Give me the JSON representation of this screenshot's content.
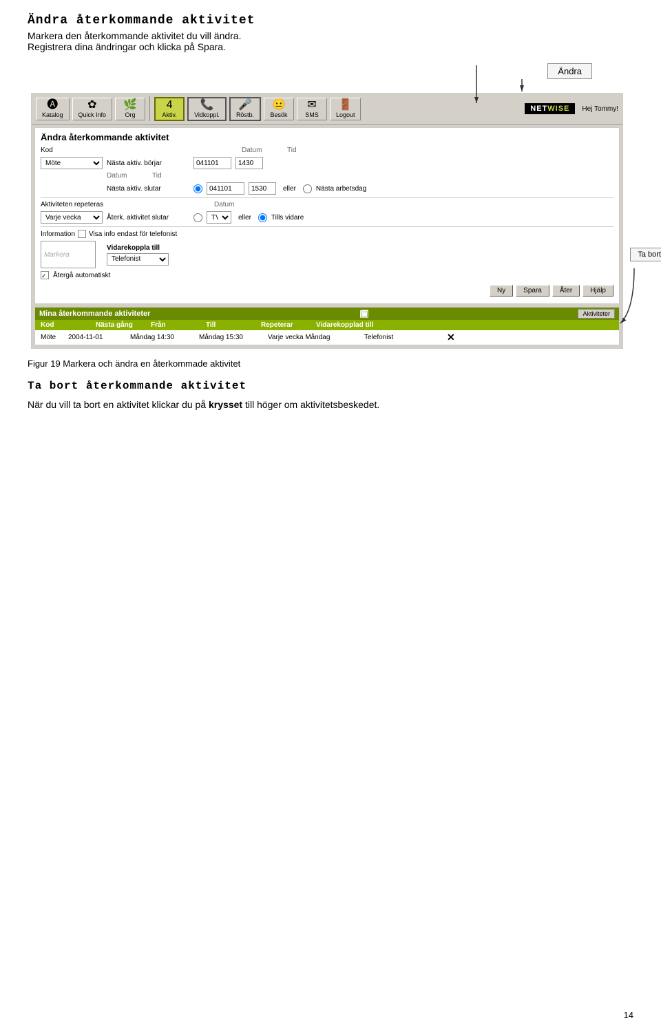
{
  "page": {
    "title": "Ändra återkommande aktivitet",
    "subtitle1": "Markera den återkommande aktivitet du vill ändra.",
    "subtitle2": "Registrera dina ändringar och klicka på Spara.",
    "andra_label": "Ändra",
    "ta_bort_label": "Ta bort",
    "figure_caption": "Figur 19  Markera och ändra en återkommade aktivitet",
    "section2_title": "Ta bort återkommande aktivitet",
    "section2_text": "När du vill ta bort en aktivitet klickar du på",
    "section2_text2": "krysset",
    "section2_text3": "till höger om aktivitetsbeskedet.",
    "page_number": "14"
  },
  "nav": {
    "katalog": "Katalog",
    "quick_info": "Quick Info",
    "org": "Org",
    "aktiv": "Aktiv.",
    "vidkoppl": "Vidkoppl.",
    "rostb": "Röstb.",
    "besok": "Besök",
    "sms": "SMS",
    "logout": "Logout",
    "hej": "Hej Tommy!"
  },
  "form": {
    "title": "Ändra återkommande aktivitet",
    "kod_label": "Kod",
    "datum_label": "Datum",
    "tid_label": "Tid",
    "nasta_aktiv_borjar": "Nästa aktiv. börjar",
    "nasta_aktiv_slutar": "Nästa aktiv. slutar",
    "eller": "eller",
    "nasta_arbetsdag": "Nästa arbetsdag",
    "aktiviteten_repeteras": "Aktiviteten repeteras",
    "aterk_aktivitet_slutar": "Återk. aktivitet slutar",
    "tills_vidare": "Tills vidare",
    "information": "Information",
    "visa_info": "Visa info endast för telefonist",
    "vidarekoppla_till": "Vidarekoppla till",
    "atergaautomatiskt": "Återgå automatiskt",
    "kod_value": "Möte",
    "datum_borjar": "041101",
    "tid_borjar": "1430",
    "datum_slutar": "041101",
    "tid_slutar": "1530",
    "repeteras_value": "Varje vecka",
    "aterk_datum": "TV",
    "vidarekoppla_value": "Telefonist"
  },
  "buttons": {
    "ny": "Ny",
    "spara": "Spara",
    "ater": "Åter",
    "hjalp": "Hjälp"
  },
  "table": {
    "title": "Mina återkommande aktiviteter",
    "aktiviteter_btn": "Aktiviteter",
    "headers": {
      "kod": "Kod",
      "nasta_gang": "Nästa gång",
      "fran": "Från",
      "till": "Till",
      "repeterar": "Repeterar",
      "vidarekopplad": "Vidarekopplad till"
    },
    "row": {
      "kod": "Möte",
      "nasta_gang": "2004-11-01",
      "fran": "Måndag 14:30",
      "till": "Måndag 15:30",
      "repeterar": "Varje vecka Måndag",
      "vidarekopplad": "Telefonist"
    }
  }
}
